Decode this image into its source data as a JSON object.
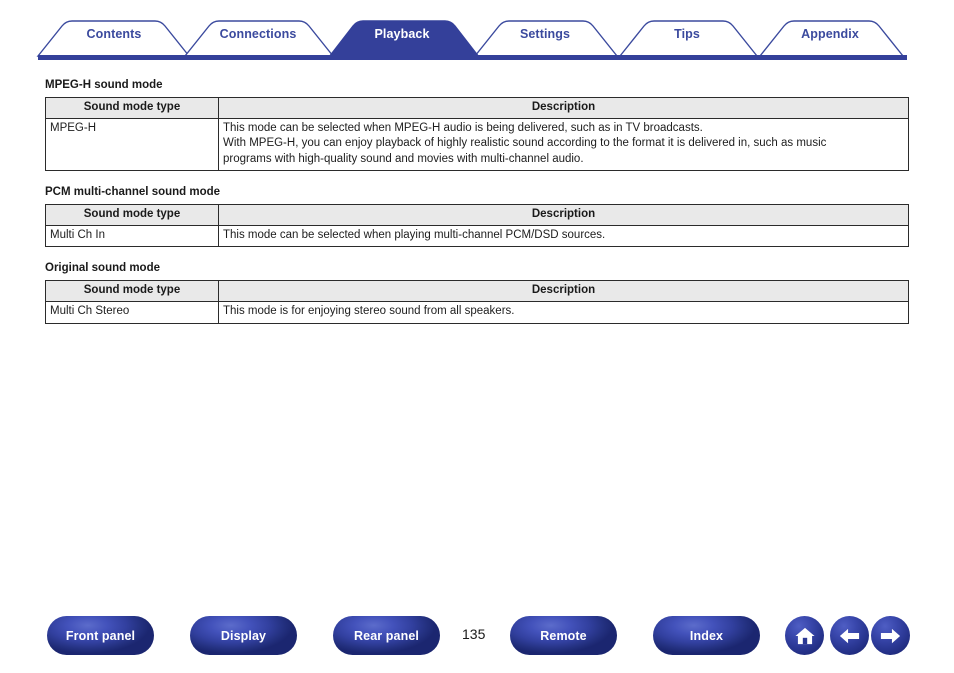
{
  "theme": {
    "brand_blue": "#3b4a9e",
    "active_tab_fill": "#34409a",
    "table_header_bg": "#e9e9e9",
    "table_border": "#2b2b2b"
  },
  "tabs": [
    {
      "label": "Contents",
      "active": false
    },
    {
      "label": "Connections",
      "active": false
    },
    {
      "label": "Playback",
      "active": true
    },
    {
      "label": "Settings",
      "active": false
    },
    {
      "label": "Tips",
      "active": false
    },
    {
      "label": "Appendix",
      "active": false
    }
  ],
  "sections": [
    {
      "title": "MPEG-H sound mode",
      "columns": [
        "Sound mode type",
        "Description"
      ],
      "rows": [
        {
          "type": "MPEG-H",
          "description_lines": [
            "This mode can be selected when MPEG-H audio is being delivered, such as in TV broadcasts.",
            "With MPEG-H, you can enjoy playback of highly realistic sound according to the format it is delivered in, such as music",
            "programs with high-quality sound and movies with multi-channel audio."
          ]
        }
      ]
    },
    {
      "title": "PCM multi-channel sound mode",
      "columns": [
        "Sound mode type",
        "Description"
      ],
      "rows": [
        {
          "type": "Multi Ch In",
          "description_lines": [
            "This mode can be selected when playing multi-channel PCM/DSD sources."
          ]
        }
      ]
    },
    {
      "title": "Original sound mode",
      "columns": [
        "Sound mode type",
        "Description"
      ],
      "rows": [
        {
          "type": "Multi Ch Stereo",
          "description_lines": [
            "This mode is for enjoying stereo sound from all speakers."
          ]
        }
      ]
    }
  ],
  "footer": {
    "buttons": [
      {
        "label": "Front panel",
        "icon": "none"
      },
      {
        "label": "Display",
        "icon": "none"
      },
      {
        "label": "Rear panel",
        "icon": "none"
      },
      {
        "label": "Remote",
        "icon": "none"
      },
      {
        "label": "Index",
        "icon": "none"
      }
    ],
    "icons": [
      {
        "name": "home-icon"
      },
      {
        "name": "arrow-left-icon"
      },
      {
        "name": "arrow-right-icon"
      }
    ],
    "page_number": "135"
  }
}
